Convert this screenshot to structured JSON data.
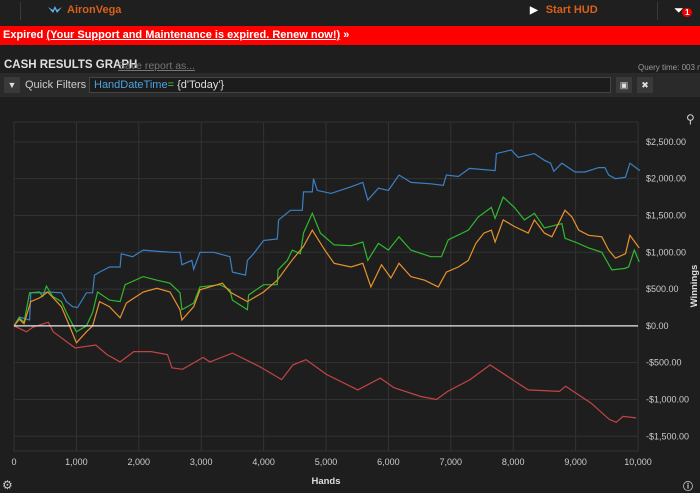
{
  "app": {
    "brand": "AironVega",
    "start_hud": "Start HUD",
    "notification_count": "1"
  },
  "banner": {
    "prefix": "Expired",
    "link": "(Your Support and Maintenance is expired.  Renew now!)",
    "arrows": "»"
  },
  "report": {
    "title": "CASH RESULTS GRAPH",
    "save_label": "Save report as...",
    "query_time": "Query time: 003 m"
  },
  "filters": {
    "label": "Quick Filters",
    "field": "HandDateTime",
    "op": "=",
    "value": " {d'Today'}"
  },
  "colors": {
    "blue": "#3c7fc4",
    "green": "#2fb82f",
    "orange": "#e8922c",
    "red": "#c44444",
    "zero": "#e8e8e8"
  },
  "chart_data": {
    "type": "line",
    "xlabel": "Hands",
    "ylabel": "Winnings",
    "xlim": [
      0,
      10000
    ],
    "ylim": [
      -1700,
      2770
    ],
    "x_ticks": [
      0,
      1000,
      2000,
      3000,
      4000,
      5000,
      6000,
      7000,
      8000,
      9000,
      10000
    ],
    "x_tick_labels": [
      "0",
      "1,000",
      "2,000",
      "3,000",
      "4,000",
      "5,000",
      "6,000",
      "7,000",
      "8,000",
      "9,000",
      "10,000"
    ],
    "y_ticks": [
      2500,
      2000,
      1500,
      1000,
      500,
      0,
      -500,
      -1000,
      -1500
    ],
    "y_tick_labels": [
      "$2,500.00",
      "$2,000.00",
      "$1,500.00",
      "$1,000.00",
      "$500.00",
      "$0.00",
      "-$500.00",
      "-$1,000.00",
      "-$1,500.00"
    ],
    "grid": true,
    "series": [
      {
        "name": "blue",
        "color": "#3c7fc4",
        "points": [
          [
            0,
            0
          ],
          [
            85,
            120
          ],
          [
            250,
            80
          ],
          [
            270,
            450
          ],
          [
            460,
            450
          ],
          [
            540,
            460
          ],
          [
            760,
            450
          ],
          [
            840,
            330
          ],
          [
            940,
            260
          ],
          [
            1020,
            250
          ],
          [
            1160,
            450
          ],
          [
            1260,
            450
          ],
          [
            1290,
            690
          ],
          [
            1370,
            730
          ],
          [
            1530,
            800
          ],
          [
            1700,
            800
          ],
          [
            1720,
            980
          ],
          [
            1900,
            940
          ],
          [
            2070,
            1030
          ],
          [
            2340,
            1010
          ],
          [
            2550,
            1000
          ],
          [
            2660,
            1000
          ],
          [
            2690,
            830
          ],
          [
            2850,
            890
          ],
          [
            2880,
            770
          ],
          [
            2980,
            1000
          ],
          [
            3200,
            1000
          ],
          [
            3460,
            940
          ],
          [
            3500,
            730
          ],
          [
            3710,
            690
          ],
          [
            3740,
            890
          ],
          [
            3840,
            980
          ],
          [
            4000,
            1160
          ],
          [
            4220,
            1180
          ],
          [
            4240,
            1440
          ],
          [
            4430,
            1570
          ],
          [
            4620,
            1570
          ],
          [
            4640,
            1820
          ],
          [
            4780,
            1820
          ],
          [
            4800,
            2000
          ],
          [
            4860,
            1840
          ],
          [
            5080,
            1800
          ],
          [
            5400,
            1890
          ],
          [
            5590,
            1950
          ],
          [
            5670,
            1710
          ],
          [
            5840,
            1870
          ],
          [
            6000,
            1840
          ],
          [
            6170,
            2050
          ],
          [
            6360,
            1950
          ],
          [
            6680,
            1930
          ],
          [
            6880,
            1910
          ],
          [
            6930,
            2050
          ],
          [
            7120,
            2030
          ],
          [
            7300,
            2140
          ],
          [
            7710,
            2110
          ],
          [
            7730,
            2340
          ],
          [
            7970,
            2390
          ],
          [
            8080,
            2290
          ],
          [
            8340,
            2340
          ],
          [
            8500,
            2250
          ],
          [
            8600,
            2210
          ],
          [
            8650,
            2100
          ],
          [
            8780,
            2210
          ],
          [
            8990,
            2090
          ],
          [
            9150,
            2090
          ],
          [
            9370,
            2150
          ],
          [
            9470,
            2150
          ],
          [
            9530,
            2050
          ],
          [
            9640,
            2000
          ],
          [
            9800,
            2020
          ],
          [
            9870,
            2210
          ],
          [
            10030,
            2110
          ]
        ]
      },
      {
        "name": "green",
        "color": "#2fb82f",
        "points": [
          [
            0,
            0
          ],
          [
            85,
            110
          ],
          [
            160,
            50
          ],
          [
            250,
            450
          ],
          [
            410,
            460
          ],
          [
            460,
            400
          ],
          [
            520,
            540
          ],
          [
            620,
            400
          ],
          [
            760,
            330
          ],
          [
            840,
            180
          ],
          [
            1000,
            -80
          ],
          [
            1160,
            0
          ],
          [
            1260,
            180
          ],
          [
            1340,
            460
          ],
          [
            1530,
            350
          ],
          [
            1700,
            330
          ],
          [
            1780,
            560
          ],
          [
            2070,
            670
          ],
          [
            2290,
            620
          ],
          [
            2500,
            580
          ],
          [
            2660,
            450
          ],
          [
            2690,
            220
          ],
          [
            2880,
            310
          ],
          [
            2980,
            530
          ],
          [
            3300,
            560
          ],
          [
            3460,
            490
          ],
          [
            3500,
            350
          ],
          [
            3740,
            220
          ],
          [
            3760,
            420
          ],
          [
            4000,
            560
          ],
          [
            4220,
            560
          ],
          [
            4230,
            760
          ],
          [
            4380,
            890
          ],
          [
            4460,
            1030
          ],
          [
            4590,
            980
          ],
          [
            4640,
            1260
          ],
          [
            4780,
            1530
          ],
          [
            4910,
            1260
          ],
          [
            5130,
            1100
          ],
          [
            5400,
            1090
          ],
          [
            5590,
            1140
          ],
          [
            5670,
            890
          ],
          [
            5840,
            1120
          ],
          [
            6000,
            1030
          ],
          [
            6170,
            1210
          ],
          [
            6360,
            1030
          ],
          [
            6680,
            940
          ],
          [
            6850,
            940
          ],
          [
            6960,
            1170
          ],
          [
            7280,
            1300
          ],
          [
            7440,
            1480
          ],
          [
            7650,
            1610
          ],
          [
            7710,
            1460
          ],
          [
            7840,
            1750
          ],
          [
            8020,
            1610
          ],
          [
            8180,
            1440
          ],
          [
            8340,
            1530
          ],
          [
            8500,
            1330
          ],
          [
            8780,
            1390
          ],
          [
            8830,
            1190
          ],
          [
            8990,
            1140
          ],
          [
            9210,
            1060
          ],
          [
            9420,
            1000
          ],
          [
            9580,
            760
          ],
          [
            9780,
            780
          ],
          [
            9850,
            800
          ],
          [
            9940,
            1030
          ],
          [
            10020,
            870
          ]
        ]
      },
      {
        "name": "orange",
        "color": "#e8922c",
        "points": [
          [
            0,
            0
          ],
          [
            85,
            90
          ],
          [
            160,
            30
          ],
          [
            270,
            330
          ],
          [
            410,
            380
          ],
          [
            540,
            460
          ],
          [
            760,
            260
          ],
          [
            890,
            0
          ],
          [
            1000,
            -230
          ],
          [
            1160,
            -80
          ],
          [
            1260,
            0
          ],
          [
            1370,
            330
          ],
          [
            1530,
            260
          ],
          [
            1700,
            110
          ],
          [
            1800,
            310
          ],
          [
            2070,
            460
          ],
          [
            2290,
            510
          ],
          [
            2500,
            460
          ],
          [
            2660,
            220
          ],
          [
            2690,
            80
          ],
          [
            2880,
            260
          ],
          [
            2980,
            490
          ],
          [
            3340,
            580
          ],
          [
            3460,
            460
          ],
          [
            3740,
            330
          ],
          [
            4000,
            460
          ],
          [
            4220,
            620
          ],
          [
            4400,
            830
          ],
          [
            4480,
            920
          ],
          [
            4640,
            1080
          ],
          [
            4780,
            1300
          ],
          [
            4980,
            1030
          ],
          [
            5130,
            850
          ],
          [
            5400,
            800
          ],
          [
            5590,
            850
          ],
          [
            5720,
            530
          ],
          [
            5890,
            830
          ],
          [
            6040,
            650
          ],
          [
            6170,
            850
          ],
          [
            6360,
            670
          ],
          [
            6580,
            620
          ],
          [
            6800,
            530
          ],
          [
            6930,
            730
          ],
          [
            7120,
            800
          ],
          [
            7280,
            890
          ],
          [
            7400,
            1120
          ],
          [
            7530,
            1260
          ],
          [
            7650,
            1300
          ],
          [
            7710,
            1140
          ],
          [
            7840,
            1440
          ],
          [
            8020,
            1350
          ],
          [
            8240,
            1260
          ],
          [
            8340,
            1440
          ],
          [
            8500,
            1260
          ],
          [
            8620,
            1210
          ],
          [
            8830,
            1570
          ],
          [
            8940,
            1480
          ],
          [
            9050,
            1300
          ],
          [
            9210,
            1230
          ],
          [
            9420,
            1210
          ],
          [
            9530,
            1030
          ],
          [
            9640,
            920
          ],
          [
            9800,
            980
          ],
          [
            9870,
            1230
          ],
          [
            10020,
            1060
          ]
        ]
      },
      {
        "name": "red",
        "color": "#c44444",
        "points": [
          [
            0,
            0
          ],
          [
            200,
            -80
          ],
          [
            300,
            -20
          ],
          [
            550,
            50
          ],
          [
            630,
            -80
          ],
          [
            980,
            -300
          ],
          [
            1310,
            -260
          ],
          [
            1490,
            -390
          ],
          [
            1700,
            -490
          ],
          [
            1920,
            -350
          ],
          [
            2200,
            -350
          ],
          [
            2460,
            -390
          ],
          [
            2530,
            -570
          ],
          [
            2700,
            -590
          ],
          [
            3030,
            -430
          ],
          [
            3140,
            -490
          ],
          [
            3500,
            -370
          ],
          [
            3930,
            -550
          ],
          [
            4290,
            -730
          ],
          [
            4470,
            -530
          ],
          [
            4680,
            -460
          ],
          [
            5010,
            -660
          ],
          [
            5510,
            -870
          ],
          [
            5870,
            -710
          ],
          [
            6090,
            -840
          ],
          [
            6520,
            -960
          ],
          [
            6770,
            -1000
          ],
          [
            6950,
            -890
          ],
          [
            7310,
            -730
          ],
          [
            7630,
            -530
          ],
          [
            7950,
            -710
          ],
          [
            8240,
            -870
          ],
          [
            8740,
            -890
          ],
          [
            8840,
            -820
          ],
          [
            9250,
            -1050
          ],
          [
            9540,
            -1270
          ],
          [
            9650,
            -1310
          ],
          [
            9760,
            -1230
          ],
          [
            9970,
            -1250
          ]
        ]
      }
    ]
  }
}
